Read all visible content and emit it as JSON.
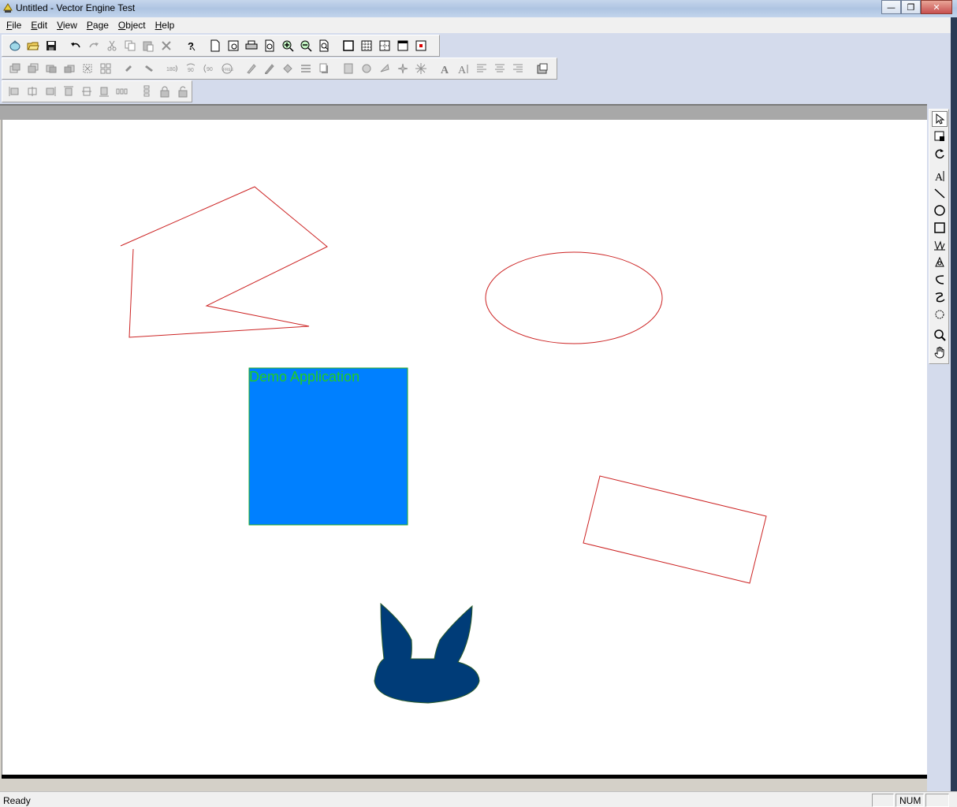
{
  "window": {
    "title": "Untitled - Vector Engine Test"
  },
  "menu": [
    {
      "label": "File",
      "accel": "F",
      "rest": "ile"
    },
    {
      "label": "Edit",
      "accel": "E",
      "rest": "dit"
    },
    {
      "label": "View",
      "accel": "V",
      "rest": "iew"
    },
    {
      "label": "Page",
      "accel": "P",
      "rest": "age"
    },
    {
      "label": "Object",
      "accel": "O",
      "rest": "bject"
    },
    {
      "label": "Help",
      "accel": "H",
      "rest": "elp"
    }
  ],
  "canvas": {
    "text_label": "Demo Application",
    "colors": {
      "outline": "#cc2222",
      "rect_fill": "#0080ff",
      "rect_border": "#22aa22",
      "blob_fill": "#003c78"
    }
  },
  "statusbar": {
    "text": "Ready",
    "num": "NUM"
  }
}
